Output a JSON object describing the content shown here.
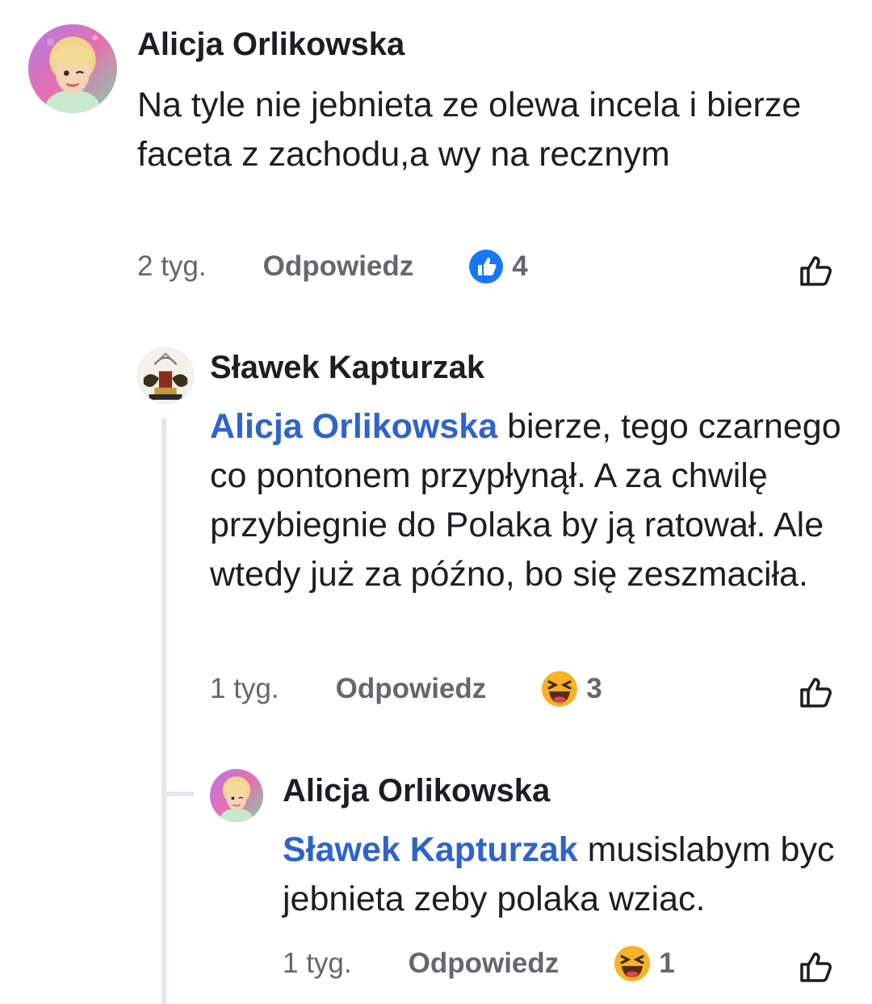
{
  "comments": [
    {
      "author": "Alicja Orlikowska",
      "mention": "",
      "text": "Na tyle nie jebnieta ze  olewa incela i bierze faceta z zachodu,a wy na recznym",
      "time": "2 tyg.",
      "reply_label": "Odpowiedz",
      "reaction_icon": "like-icon",
      "reaction_count": "4"
    },
    {
      "author": "Sławek Kapturzak",
      "mention": "Alicja Orlikowska",
      "text": "bierze, tego czarnego co pontonem przypłynął. A za chwilę przybiegnie do Polaka by ją ratował. Ale wtedy już za późno, bo się zeszmaciła.",
      "time": "1 tyg.",
      "reply_label": "Odpowiedz",
      "reaction_icon": "haha-icon",
      "reaction_count": "3"
    },
    {
      "author": "Alicja Orlikowska",
      "mention": "Sławek Kapturzak",
      "text": "musislabym byc jebnieta zeby polaka wziac.",
      "time": "1 tyg.",
      "reply_label": "Odpowiedz",
      "reaction_icon": "haha-icon",
      "reaction_count": "1"
    }
  ],
  "colors": {
    "mention": "#2f63cc",
    "secondary_text": "#65676b",
    "like_blue": "#1877f2",
    "haha_yellow": "#f7b125",
    "thread_line": "#e4e6eb"
  }
}
